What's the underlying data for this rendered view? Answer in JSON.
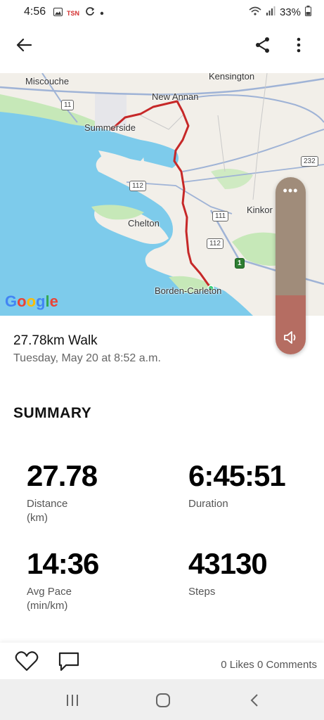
{
  "status_bar": {
    "time": "4:56",
    "battery": "33%",
    "icons": [
      "gallery-icon",
      "tsn-icon",
      "sync-icon",
      "dot-icon",
      "wifi-icon",
      "signal-icon",
      "battery-icon"
    ]
  },
  "app_bar": {
    "back_icon": "arrow-left-icon",
    "share_icon": "share-icon",
    "more_icon": "more-vertical-icon"
  },
  "map": {
    "labels": {
      "miscouche": "Miscouche",
      "kensington": "Kensington",
      "new_annan": "New Annan",
      "summerside": "Summerside",
      "chelton": "Chelton",
      "kinkora": "Kinkor",
      "borden": "Borden-Carleton"
    },
    "shields": {
      "r11": "11",
      "r112a": "112",
      "r111": "111",
      "r112b": "112",
      "r232": "232",
      "r1": "1"
    },
    "attribution": "Google",
    "colors": {
      "water": "#7dcbeb",
      "land": "#f2efe9",
      "park": "#c6e8b8",
      "route": "#c62828"
    }
  },
  "volume": {
    "more_icon": "more-horizontal-icon",
    "speaker_icon": "speaker-icon"
  },
  "activity": {
    "title": "27.78km Walk",
    "date": "Tuesday, May 20 at 8:52 a.m."
  },
  "summary": {
    "heading": "SUMMARY",
    "stats": [
      {
        "value": "27.78",
        "label": "Distance\n(km)"
      },
      {
        "value": "6:45:51",
        "label": "Duration"
      },
      {
        "value": "14:36",
        "label": "Avg Pace\n(min/km)"
      },
      {
        "value": "43130",
        "label": "Steps"
      }
    ]
  },
  "social": {
    "like_icon": "heart-icon",
    "comment_icon": "comment-icon",
    "counts": "0 Likes 0 Comments"
  },
  "nav": {
    "recents_icon": "recents-icon",
    "home_icon": "home-icon",
    "back_icon": "chevron-left-icon"
  }
}
